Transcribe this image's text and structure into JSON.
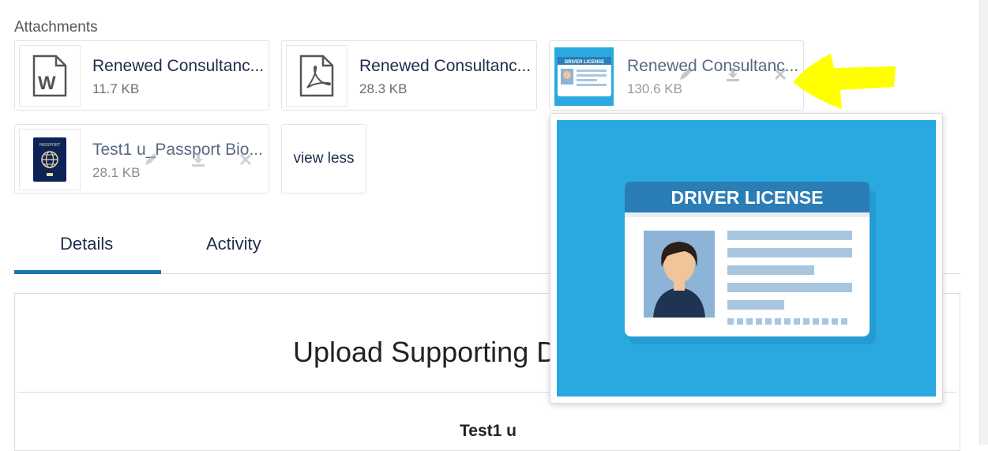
{
  "attachments_label": "Attachments",
  "attachments": [
    {
      "name": "Renewed Consultanc...",
      "size": "11.7 KB",
      "icon": "word-doc-icon"
    },
    {
      "name": "Renewed Consultanc...",
      "size": "28.3 KB",
      "icon": "pdf-icon"
    },
    {
      "name": "Renewed Consultanc...",
      "size": "130.6 KB",
      "icon": "driver-license-thumbnail"
    },
    {
      "name": "Test1 u_Passport Bio...",
      "size": "28.1 KB",
      "icon": "passport-thumbnail"
    }
  ],
  "view_less": "view less",
  "tabs": [
    {
      "label": "Details",
      "active": true
    },
    {
      "label": "Activity",
      "active": false
    }
  ],
  "panel": {
    "title": "Upload Supporting D",
    "user": "Test1 u"
  },
  "preview": {
    "card_title": "DRIVER LICENSE",
    "thumb_title": "DRIVER LICENSE",
    "passport_text": "PASSPORT"
  },
  "colors": {
    "accent": "#1874b0",
    "text_primary": "#1f2d4d",
    "preview_bg": "#2aa9e1",
    "card_header": "#2b7db5",
    "highlight_arrow": "#ffff00"
  }
}
